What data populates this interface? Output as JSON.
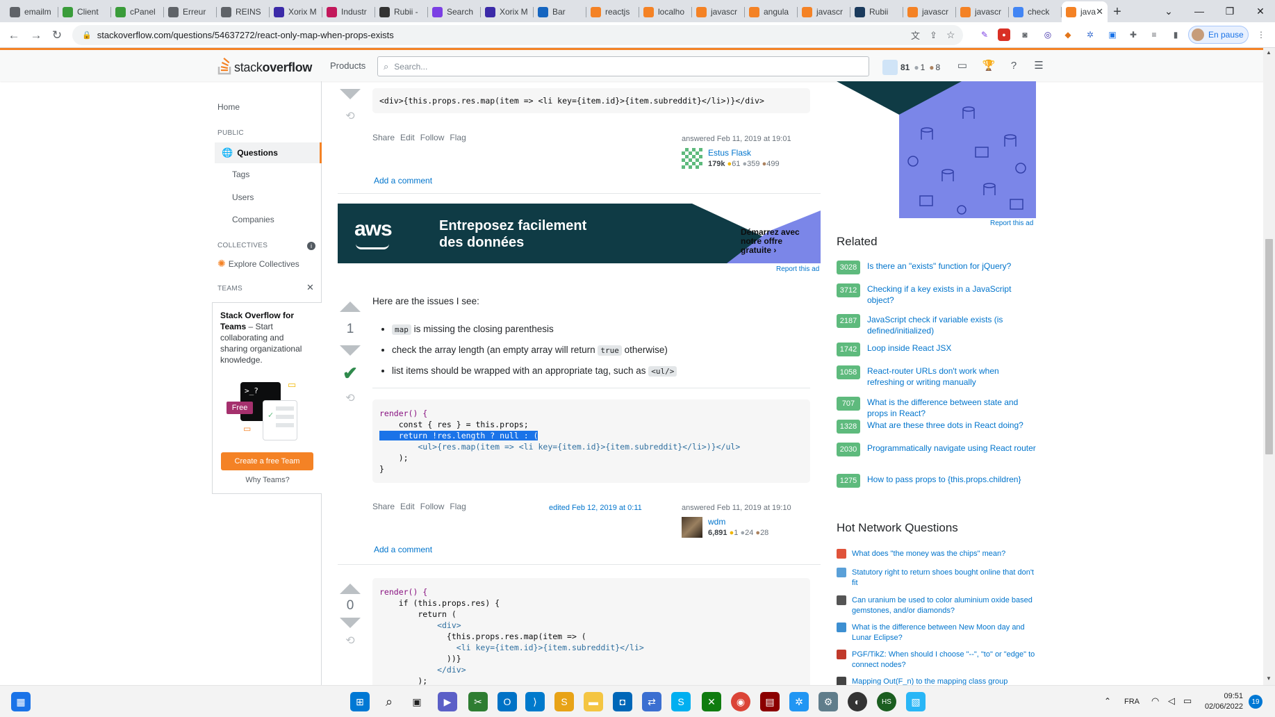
{
  "browser": {
    "tabs": [
      {
        "label": "emailm",
        "color": "#5f6368"
      },
      {
        "label": "Client",
        "color": "#3a9c3a"
      },
      {
        "label": "cPanel",
        "color": "#3a9c3a"
      },
      {
        "label": "Erreur",
        "color": "#5f6368"
      },
      {
        "label": "REINS",
        "color": "#5f6368"
      },
      {
        "label": "Xorix M",
        "color": "#3b2aa8"
      },
      {
        "label": "Industr",
        "color": "#c2185b"
      },
      {
        "label": "Rubii -",
        "color": "#333333"
      },
      {
        "label": "Search",
        "color": "#7b3fe4"
      },
      {
        "label": "Xorix M",
        "color": "#3b2aa8"
      },
      {
        "label": "Bar",
        "color": "#1565c0"
      },
      {
        "label": "reactjs",
        "color": "#f48225"
      },
      {
        "label": "localho",
        "color": "#f48225"
      },
      {
        "label": "javascr",
        "color": "#f48225"
      },
      {
        "label": "angula",
        "color": "#f48225"
      },
      {
        "label": "javascr",
        "color": "#f48225"
      },
      {
        "label": "Rubii",
        "color": "#1a3a5c"
      },
      {
        "label": "javascr",
        "color": "#f48225"
      },
      {
        "label": "javascr",
        "color": "#f48225"
      },
      {
        "label": "check",
        "color": "#4285f4"
      }
    ],
    "active_tab": {
      "label": "java",
      "color": "#f48225"
    },
    "url": "stackoverflow.com/questions/54637272/react-only-map-when-props-exists",
    "profile_label": "En pause"
  },
  "so": {
    "logo_light": "stack",
    "logo_bold": "overflow",
    "products": "Products",
    "search_placeholder": "Search...",
    "rep": "81",
    "silver": "1",
    "bronze": "8"
  },
  "leftnav": {
    "home": "Home",
    "public": "PUBLIC",
    "questions": "Questions",
    "tags": "Tags",
    "users": "Users",
    "companies": "Companies",
    "collectives": "COLLECTIVES",
    "explore": "Explore Collectives",
    "teams": "TEAMS",
    "teams_title": "Stack Overflow for Teams",
    "teams_desc_1": " – Start",
    "teams_desc_2": "collaborating and",
    "teams_desc_3": "sharing organizational",
    "teams_desc_4": "knowledge.",
    "free": "Free",
    "create_btn": "Create a free Team",
    "why": "Why Teams?"
  },
  "answer1": {
    "code_line": "<div>{this.props.res.map(item => <li key={item.id}>{item.subreddit}</li>)}</div>",
    "share": "Share",
    "edit": "Edit",
    "follow": "Follow",
    "flag": "Flag",
    "answered": "answered Feb 11, 2019 at 19:01",
    "user": "Estus Flask",
    "rep": "179k",
    "gold": "61",
    "silver": "359",
    "bronze": "499",
    "add_comment": "Add a comment"
  },
  "ad": {
    "brand": "aws",
    "headline_1": "Entreposez facilement",
    "headline_2": "des données",
    "cta_1": "Démarrez avec",
    "cta_2": "notre offre",
    "cta_3": "gratuite ›",
    "report": "Report this ad"
  },
  "answer2": {
    "score": "1",
    "intro": "Here are the issues I see:",
    "bullet1_code": "map",
    "bullet1_text": " is missing the closing parenthesis",
    "bullet2_a": "check the array length (an empty array will return ",
    "bullet2_code": "true",
    "bullet2_b": " otherwise)",
    "bullet3_a": "list items should be wrapped with an appropriate tag, such as ",
    "bullet3_code": "<ul/>",
    "code": {
      "l1": "render() {",
      "l2": "    const { res } = this.props;",
      "l3": "    return !res.length ? null : (",
      "l4": "        <ul>{res.map(item => <li key={item.id}>{item.subreddit}</li>)}</ul>",
      "l5": "    );",
      "l6": "}"
    },
    "share": "Share",
    "edit": "Edit",
    "follow": "Follow",
    "flag": "Flag",
    "edited": "edited Feb 12, 2019 at 0:11",
    "answered": "answered Feb 11, 2019 at 19:10",
    "user": "wdm",
    "rep": "6,891",
    "gold": "1",
    "silver": "24",
    "bronze": "28",
    "add_comment": "Add a comment"
  },
  "answer3": {
    "score": "0",
    "code": {
      "l1": "render() {",
      "l2": "    if (this.props.res) {",
      "l3": "        return (",
      "l4": "            <div>",
      "l5": "              {this.props.res.map(item => (",
      "l6": "                <li key={item.id}>{item.subreddit}</li>",
      "l7": "              ))}",
      "l8": "            </div>",
      "l9": "        );"
    }
  },
  "right": {
    "report_ad": "Report this ad",
    "related_title": "Related",
    "related": [
      {
        "count": "3028",
        "title": "Is there an \"exists\" function for jQuery?"
      },
      {
        "count": "3712",
        "title": "Checking if a key exists in a JavaScript object?"
      },
      {
        "count": "2187",
        "title": "JavaScript check if variable exists (is defined/initialized)"
      },
      {
        "count": "1742",
        "title": "Loop inside React JSX"
      },
      {
        "count": "1058",
        "title": "React-router URLs don't work when refreshing or writing manually"
      },
      {
        "count": "707",
        "title": "What is the difference between state and props in React?"
      },
      {
        "count": "1328",
        "title": "What are these three dots in React doing?"
      },
      {
        "count": "2030",
        "title": "Programmatically navigate using React router"
      },
      {
        "count": "1275",
        "title": "How to pass props to {this.props.children}"
      }
    ],
    "hnq_title": "Hot Network Questions",
    "hnq": [
      {
        "title": "What does \"the money was the chips\" mean?",
        "color": "#e0533a"
      },
      {
        "title": "Statutory right to return shoes bought online that don't fit",
        "color": "#5aa0d8"
      },
      {
        "title": "Can uranium be used to color aluminium oxide based gemstones, and/or diamonds?",
        "color": "#555555"
      },
      {
        "title": "What is the difference between New Moon day and Lunar Eclipse?",
        "color": "#3d8fd1"
      },
      {
        "title": "PGF/TikZ: When should I choose \"--\", \"to\" or \"edge\" to connect nodes?",
        "color": "#c0392b"
      },
      {
        "title": "Mapping Out(F_n) to the mapping class group",
        "color": "#444444"
      }
    ]
  },
  "taskbar": {
    "lang": "FRA",
    "time": "09:51",
    "date": "02/06/2022",
    "notif": "19"
  }
}
